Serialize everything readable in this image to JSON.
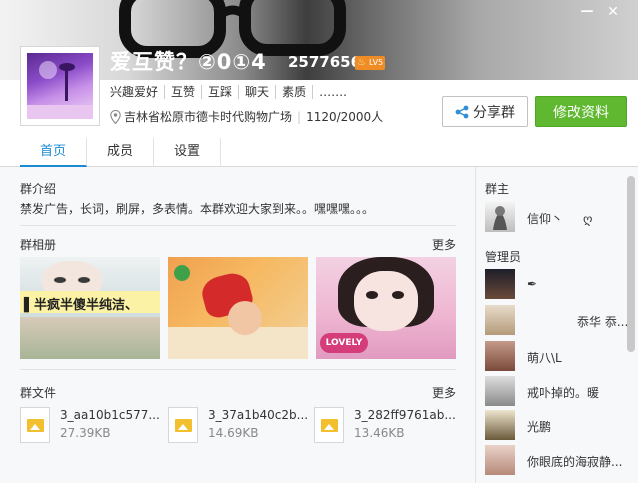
{
  "window": {
    "minimize_glyph": "—",
    "close_glyph": "✕",
    "banner_colors": [
      "#f3f3f3",
      "#3e3e3e",
      "#d0d0d0"
    ]
  },
  "group": {
    "name": "爱互赞？②0①4",
    "id": "25776565",
    "level": "LV5",
    "tags": [
      "兴趣爱好",
      "互赞",
      "互踩",
      "聊天",
      "素质",
      "……."
    ],
    "location": "吉林省松原市德卡时代购物广场",
    "member_count": "1120/2000人"
  },
  "buttons": {
    "share_label": "分享群",
    "edit_label": "修改资料",
    "accent_green": "#5fb830"
  },
  "tabs": [
    {
      "label": "首页",
      "active": true
    },
    {
      "label": "成员",
      "active": false
    },
    {
      "label": "设置",
      "active": false
    }
  ],
  "intro": {
    "title": "群介绍",
    "text": "禁发广告，长词，刷屏，多表情。本群欢迎大家到来。。嘿嘿嘿。。。"
  },
  "album": {
    "title": "群相册",
    "more": "更多",
    "photo1_caption": "▌半疯半傻半纯洁、",
    "photo3_caption": "LOVELY"
  },
  "files": {
    "title": "群文件",
    "more": "更多",
    "items": [
      {
        "name": "3_aa10b1c577...",
        "size": "27.39KB"
      },
      {
        "name": "3_37a1b40c2b...",
        "size": "14.69KB"
      },
      {
        "name": "3_282ff9761ab...",
        "size": "13.46KB"
      }
    ]
  },
  "owner": {
    "title": "群主",
    "name": "信仰丶",
    "badge": "ღ"
  },
  "admins": {
    "title": "管理员",
    "items": [
      {
        "name": "✒"
      },
      {
        "name": "忝华 忝..."
      },
      {
        "name": "萌八\\L"
      },
      {
        "name": "戒卟掉的。暖"
      },
      {
        "name": "光鹏"
      },
      {
        "name": "你眼底的海寂静..."
      }
    ]
  }
}
